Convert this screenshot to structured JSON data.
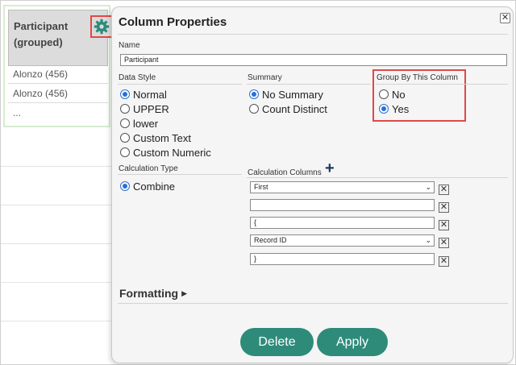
{
  "column": {
    "header": "Participant (grouped)",
    "rows": [
      "Alonzo (456)",
      "Alonzo (456)",
      "..."
    ]
  },
  "dialog": {
    "title": "Column Properties",
    "close_symbol": "✕",
    "name_label": "Name",
    "name_value": "Participant",
    "data_style": {
      "label": "Data Style",
      "options": [
        "Normal",
        "UPPER",
        "lower",
        "Custom Text",
        "Custom Numeric"
      ],
      "selected": "Normal"
    },
    "summary": {
      "label": "Summary",
      "options": [
        "No Summary",
        "Count Distinct"
      ],
      "selected": "No Summary"
    },
    "group_by": {
      "label": "Group By This Column",
      "options": [
        "No",
        "Yes"
      ],
      "selected": "Yes"
    },
    "calc_type": {
      "label": "Calculation Type",
      "options": [
        "Combine"
      ],
      "selected": "Combine"
    },
    "calc_columns": {
      "label": "Calculation Columns",
      "add_symbol": "+",
      "entries": [
        {
          "kind": "select",
          "value": "First"
        },
        {
          "kind": "input",
          "value": ""
        },
        {
          "kind": "input",
          "value": "{"
        },
        {
          "kind": "select",
          "value": "Record ID"
        },
        {
          "kind": "input",
          "value": "}"
        }
      ]
    },
    "formatting_label": "Formatting",
    "delete_label": "Delete",
    "apply_label": "Apply"
  },
  "colors": {
    "accent": "#2e8b7a",
    "highlight_border": "#e04848",
    "radio_selected": "#2a6fd6",
    "gear": "#2e8b7a"
  },
  "icons": {
    "gear": "gear-icon",
    "close": "close-icon",
    "add": "plus-icon",
    "remove": "remove-icon",
    "caret": "chevron-down-icon",
    "disclosure": "triangle-right-icon"
  }
}
